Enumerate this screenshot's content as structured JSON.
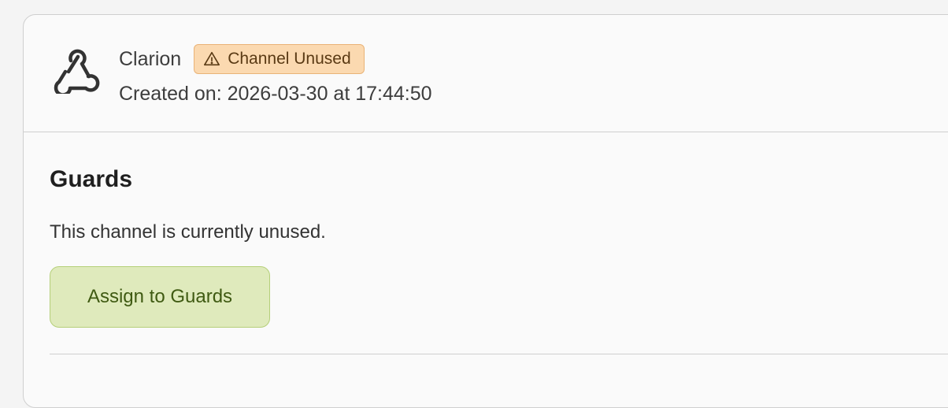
{
  "channel": {
    "name": "Clarion",
    "icon": "webhook-icon",
    "status_badge": {
      "label": "Channel Unused",
      "icon": "warning-icon",
      "color": "#fbd9b0"
    },
    "created_text": "Created on: 2026-03-30 at 17:44:50"
  },
  "guards_section": {
    "title": "Guards",
    "description": "This channel is currently unused.",
    "assign_button_label": "Assign to Guards"
  }
}
